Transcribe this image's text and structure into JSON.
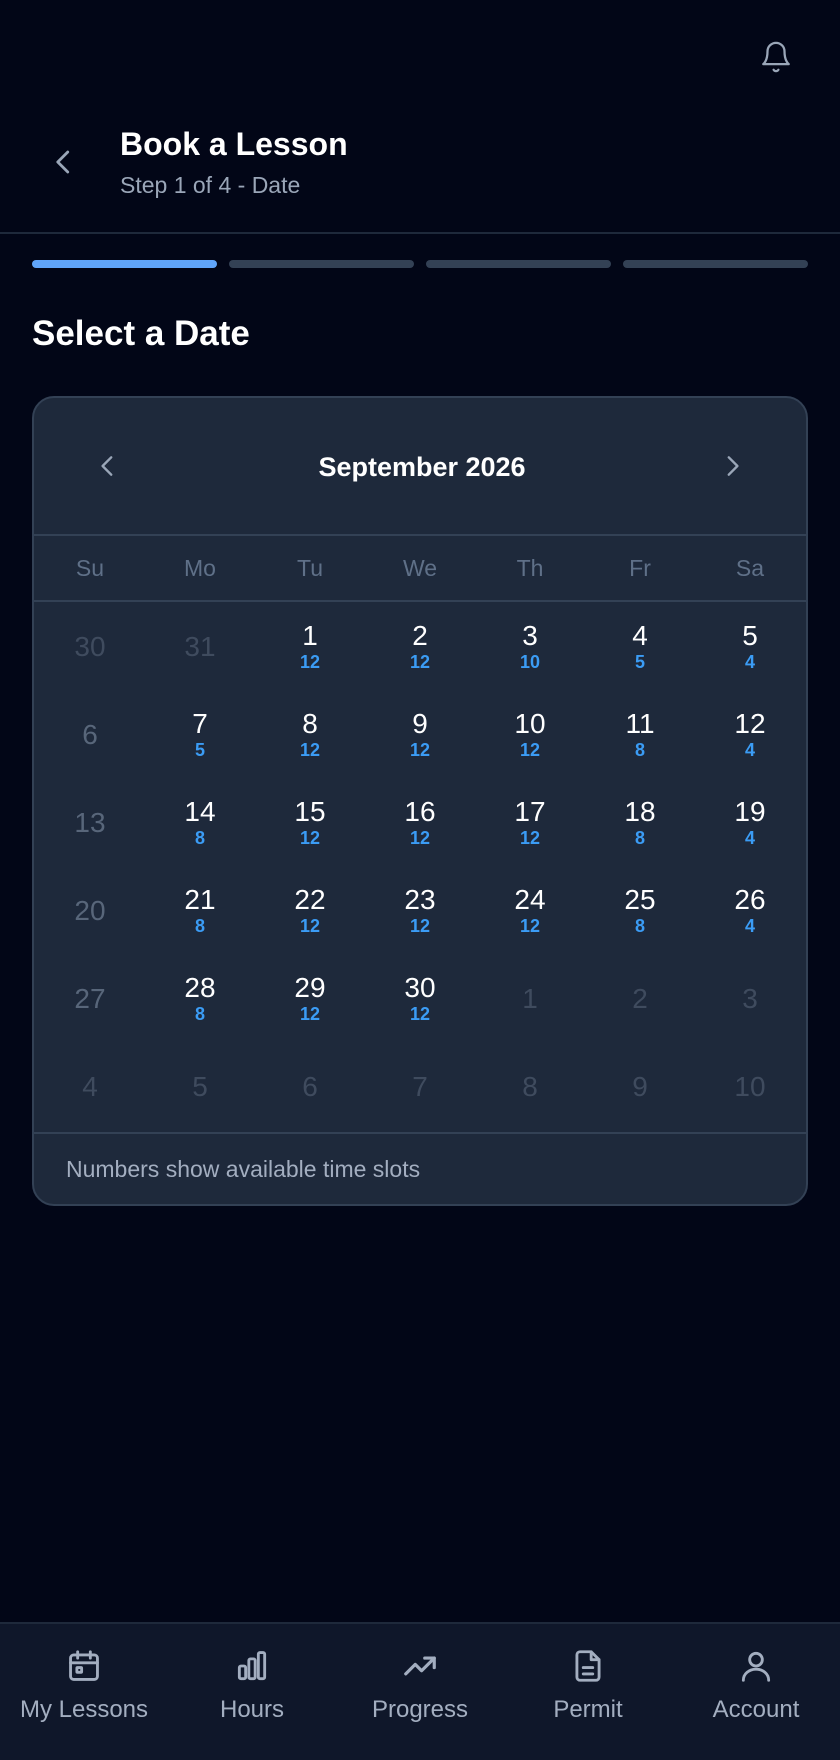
{
  "header": {
    "title": "Book a Lesson",
    "subtitle": "Step 1 of 4 - Date",
    "icons": {
      "back": "chevron-left-icon",
      "notifications": "bell-icon"
    }
  },
  "progress": {
    "current_step": 1,
    "total_steps": 4
  },
  "section_title": "Select a Date",
  "calendar": {
    "month_label": "September 2026",
    "weekdays": [
      "Su",
      "Mo",
      "Tu",
      "We",
      "Th",
      "Fr",
      "Sa"
    ],
    "days": [
      {
        "day": "30",
        "slots": "",
        "state": "muted"
      },
      {
        "day": "31",
        "slots": "",
        "state": "muted"
      },
      {
        "day": "1",
        "slots": "12",
        "state": "available"
      },
      {
        "day": "2",
        "slots": "12",
        "state": "available"
      },
      {
        "day": "3",
        "slots": "10",
        "state": "available"
      },
      {
        "day": "4",
        "slots": "5",
        "state": "available"
      },
      {
        "day": "5",
        "slots": "4",
        "state": "available"
      },
      {
        "day": "6",
        "slots": "",
        "state": "disabled"
      },
      {
        "day": "7",
        "slots": "5",
        "state": "available"
      },
      {
        "day": "8",
        "slots": "12",
        "state": "available"
      },
      {
        "day": "9",
        "slots": "12",
        "state": "available"
      },
      {
        "day": "10",
        "slots": "12",
        "state": "available"
      },
      {
        "day": "11",
        "slots": "8",
        "state": "available"
      },
      {
        "day": "12",
        "slots": "4",
        "state": "available"
      },
      {
        "day": "13",
        "slots": "",
        "state": "disabled"
      },
      {
        "day": "14",
        "slots": "8",
        "state": "available"
      },
      {
        "day": "15",
        "slots": "12",
        "state": "available"
      },
      {
        "day": "16",
        "slots": "12",
        "state": "available"
      },
      {
        "day": "17",
        "slots": "12",
        "state": "available"
      },
      {
        "day": "18",
        "slots": "8",
        "state": "available"
      },
      {
        "day": "19",
        "slots": "4",
        "state": "available"
      },
      {
        "day": "20",
        "slots": "",
        "state": "disabled"
      },
      {
        "day": "21",
        "slots": "8",
        "state": "available"
      },
      {
        "day": "22",
        "slots": "12",
        "state": "available"
      },
      {
        "day": "23",
        "slots": "12",
        "state": "available"
      },
      {
        "day": "24",
        "slots": "12",
        "state": "available"
      },
      {
        "day": "25",
        "slots": "8",
        "state": "available"
      },
      {
        "day": "26",
        "slots": "4",
        "state": "available"
      },
      {
        "day": "27",
        "slots": "",
        "state": "disabled"
      },
      {
        "day": "28",
        "slots": "8",
        "state": "available"
      },
      {
        "day": "29",
        "slots": "12",
        "state": "available"
      },
      {
        "day": "30",
        "slots": "12",
        "state": "available"
      },
      {
        "day": "1",
        "slots": "",
        "state": "muted"
      },
      {
        "day": "2",
        "slots": "",
        "state": "muted"
      },
      {
        "day": "3",
        "slots": "",
        "state": "muted"
      },
      {
        "day": "4",
        "slots": "",
        "state": "muted"
      },
      {
        "day": "5",
        "slots": "",
        "state": "muted"
      },
      {
        "day": "6",
        "slots": "",
        "state": "muted"
      },
      {
        "day": "7",
        "slots": "",
        "state": "muted"
      },
      {
        "day": "8",
        "slots": "",
        "state": "muted"
      },
      {
        "day": "9",
        "slots": "",
        "state": "muted"
      },
      {
        "day": "10",
        "slots": "",
        "state": "muted"
      }
    ],
    "footer_note": "Numbers show available time slots",
    "icons": {
      "prev": "chevron-left-icon",
      "next": "chevron-right-icon"
    }
  },
  "bottom_nav": [
    {
      "label": "My Lessons",
      "icon": "calendar-icon"
    },
    {
      "label": "Hours",
      "icon": "bar-chart-icon"
    },
    {
      "label": "Progress",
      "icon": "trending-up-icon"
    },
    {
      "label": "Permit",
      "icon": "document-icon"
    },
    {
      "label": "Account",
      "icon": "user-icon"
    }
  ],
  "colors": {
    "background": "#020617",
    "card": "#1e293b",
    "accent": "#60a5fa",
    "slot_count": "#3b9cf5",
    "muted_text": "#a3aec0"
  }
}
